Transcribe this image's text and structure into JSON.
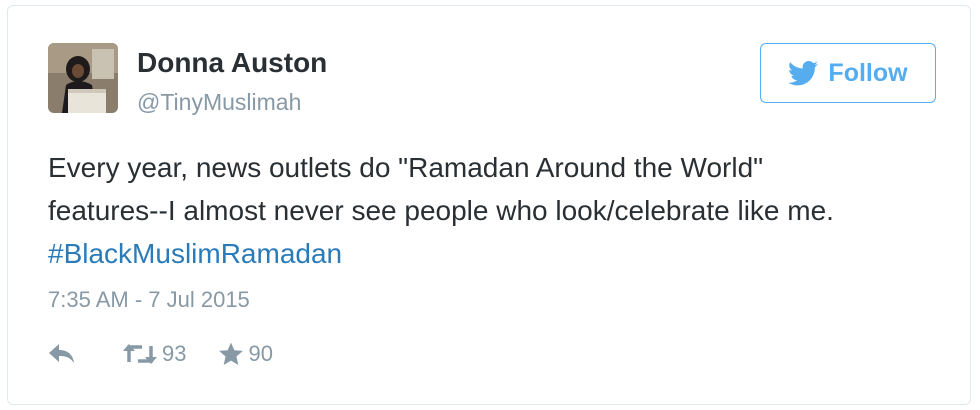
{
  "tweet": {
    "author": {
      "name": "Donna Auston",
      "handle": "@TinyMuslimah",
      "avatar_icon": "profile-photo"
    },
    "follow_button": {
      "label": "Follow",
      "icon": "twitter-bird-icon",
      "color": "#55acee"
    },
    "text_lines": [
      "Every year, news outlets do \"Ramadan Around the World\"",
      "features--I almost never see people who look/celebrate like me."
    ],
    "hashtag": "#BlackMuslimRamadan",
    "timestamp": "7:35 AM - 7 Jul 2015",
    "actions": {
      "reply_icon": "reply-icon",
      "retweet_icon": "retweet-icon",
      "retweet_count": "93",
      "favorite_icon": "star-icon",
      "favorite_count": "90"
    }
  },
  "colors": {
    "text": "#292f33",
    "muted": "#8899a6",
    "link": "#2b7bb9",
    "border": "#e1e8ed"
  }
}
